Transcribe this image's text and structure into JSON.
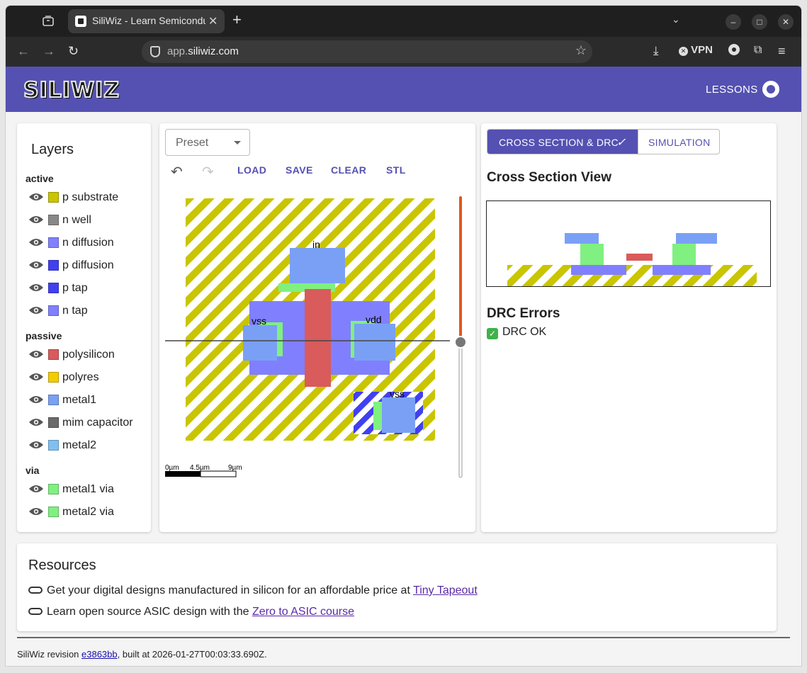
{
  "browser": {
    "tab_title": "SiliWiz - Learn Semiconductor Design",
    "url_prefix": "app.",
    "url_host": "siliwiz.com",
    "vpn_label": "VPN"
  },
  "app": {
    "logo": "SILIWIZ",
    "lessons_label": "LESSONS"
  },
  "layers": {
    "title": "Layers",
    "groups": [
      {
        "name": "active",
        "items": [
          {
            "label": "p substrate",
            "color": "#c9c500"
          },
          {
            "label": "n well",
            "color": "#888888"
          },
          {
            "label": "n diffusion",
            "color": "#8080ff"
          },
          {
            "label": "p diffusion",
            "color": "#4040f0"
          },
          {
            "label": "p tap",
            "color": "#4040f0"
          },
          {
            "label": "n tap",
            "color": "#8080ff"
          }
        ]
      },
      {
        "name": "passive",
        "items": [
          {
            "label": "polysilicon",
            "color": "#d95b5b"
          },
          {
            "label": "polyres",
            "color": "#f2cc00"
          },
          {
            "label": "metal1",
            "color": "#7aa0f5"
          },
          {
            "label": "mim capacitor",
            "color": "#6a6a6a"
          },
          {
            "label": "metal2",
            "color": "#80c0f0"
          }
        ]
      },
      {
        "name": "via",
        "items": [
          {
            "label": "metal1 via",
            "color": "#80f080"
          },
          {
            "label": "metal2 via",
            "color": "#80f080"
          }
        ]
      }
    ]
  },
  "editor": {
    "preset_placeholder": "Preset",
    "load_label": "LOAD",
    "save_label": "SAVE",
    "clear_label": "CLEAR",
    "stl_label": "STL",
    "labels": {
      "in": "in",
      "vss1": "vss",
      "vdd": "vdd",
      "vss2": "vss"
    },
    "scale": {
      "s0": "0µm",
      "s1": "4.5µm",
      "s2": "9µm"
    }
  },
  "right": {
    "tab_cross": "CROSS SECTION & DRC",
    "tab_sim": "SIMULATION",
    "cross_title": "Cross Section View",
    "drc_title": "DRC Errors",
    "drc_status": "DRC OK"
  },
  "resources": {
    "title": "Resources",
    "line1_text": "Get your digital designs manufactured in silicon for an affordable price at ",
    "line1_link": "Tiny Tapeout",
    "line2_text": "Learn open source ASIC design with the ",
    "line2_link": "Zero to ASIC course"
  },
  "footer": {
    "prefix": "SiliWiz revision ",
    "revision": "e3863bb",
    "suffix": ", built at 2026-01-27T00:03:33.690Z."
  },
  "colors": {
    "accent": "#5451b2",
    "substrate": "#c9c500",
    "poly": "#d95b5b",
    "metal1": "#7aa0f5",
    "ndiff": "#8080ff",
    "pdiff": "#4040f0",
    "via": "#80f080",
    "slider": "#e2581c"
  }
}
